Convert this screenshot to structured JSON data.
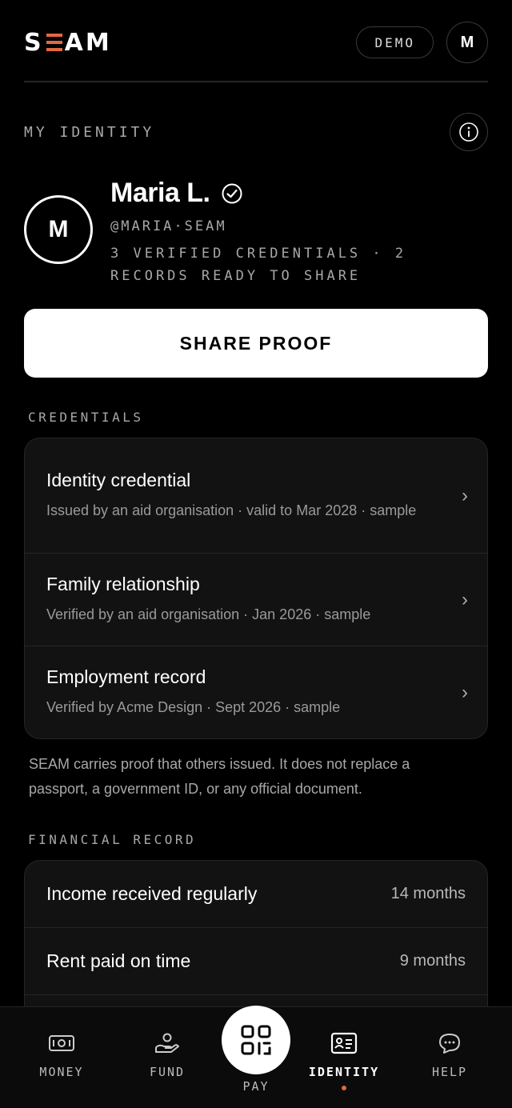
{
  "header": {
    "logo": "SEAM",
    "demo_label": "DEMO",
    "avatar_initial": "M"
  },
  "identity": {
    "section_title": "MY IDENTITY",
    "avatar_initial": "M",
    "name": "Maria L.",
    "handle": "@MARIA·SEAM",
    "summary": "3 VERIFIED CREDENTIALS · 2 RECORDS READY TO SHARE",
    "share_label": "SHARE PROOF"
  },
  "credentials": {
    "label": "CREDENTIALS",
    "items": [
      {
        "title": "Identity credential",
        "subtitle": "Issued by an aid organisation · valid to Mar 2028 · sample"
      },
      {
        "title": "Family relationship",
        "subtitle": "Verified by an aid organisation · Jan 2026 · sample"
      },
      {
        "title": "Employment record",
        "subtitle": "Verified by Acme Design · Sept 2026 · sample"
      }
    ],
    "disclaimer": "SEAM carries proof that others issued. It does not replace a passport, a government ID, or any official document."
  },
  "financial": {
    "label": "FINANCIAL RECORD",
    "items": [
      {
        "label": "Income received regularly",
        "value": "14 months"
      },
      {
        "label": "Rent paid on time",
        "value": "9 months"
      }
    ]
  },
  "nav": {
    "money": "MONEY",
    "fund": "FUND",
    "pay": "PAY",
    "identity": "IDENTITY",
    "help": "HELP"
  },
  "colors": {
    "accent": "#e4683f",
    "background": "#000000",
    "card": "#121212"
  }
}
